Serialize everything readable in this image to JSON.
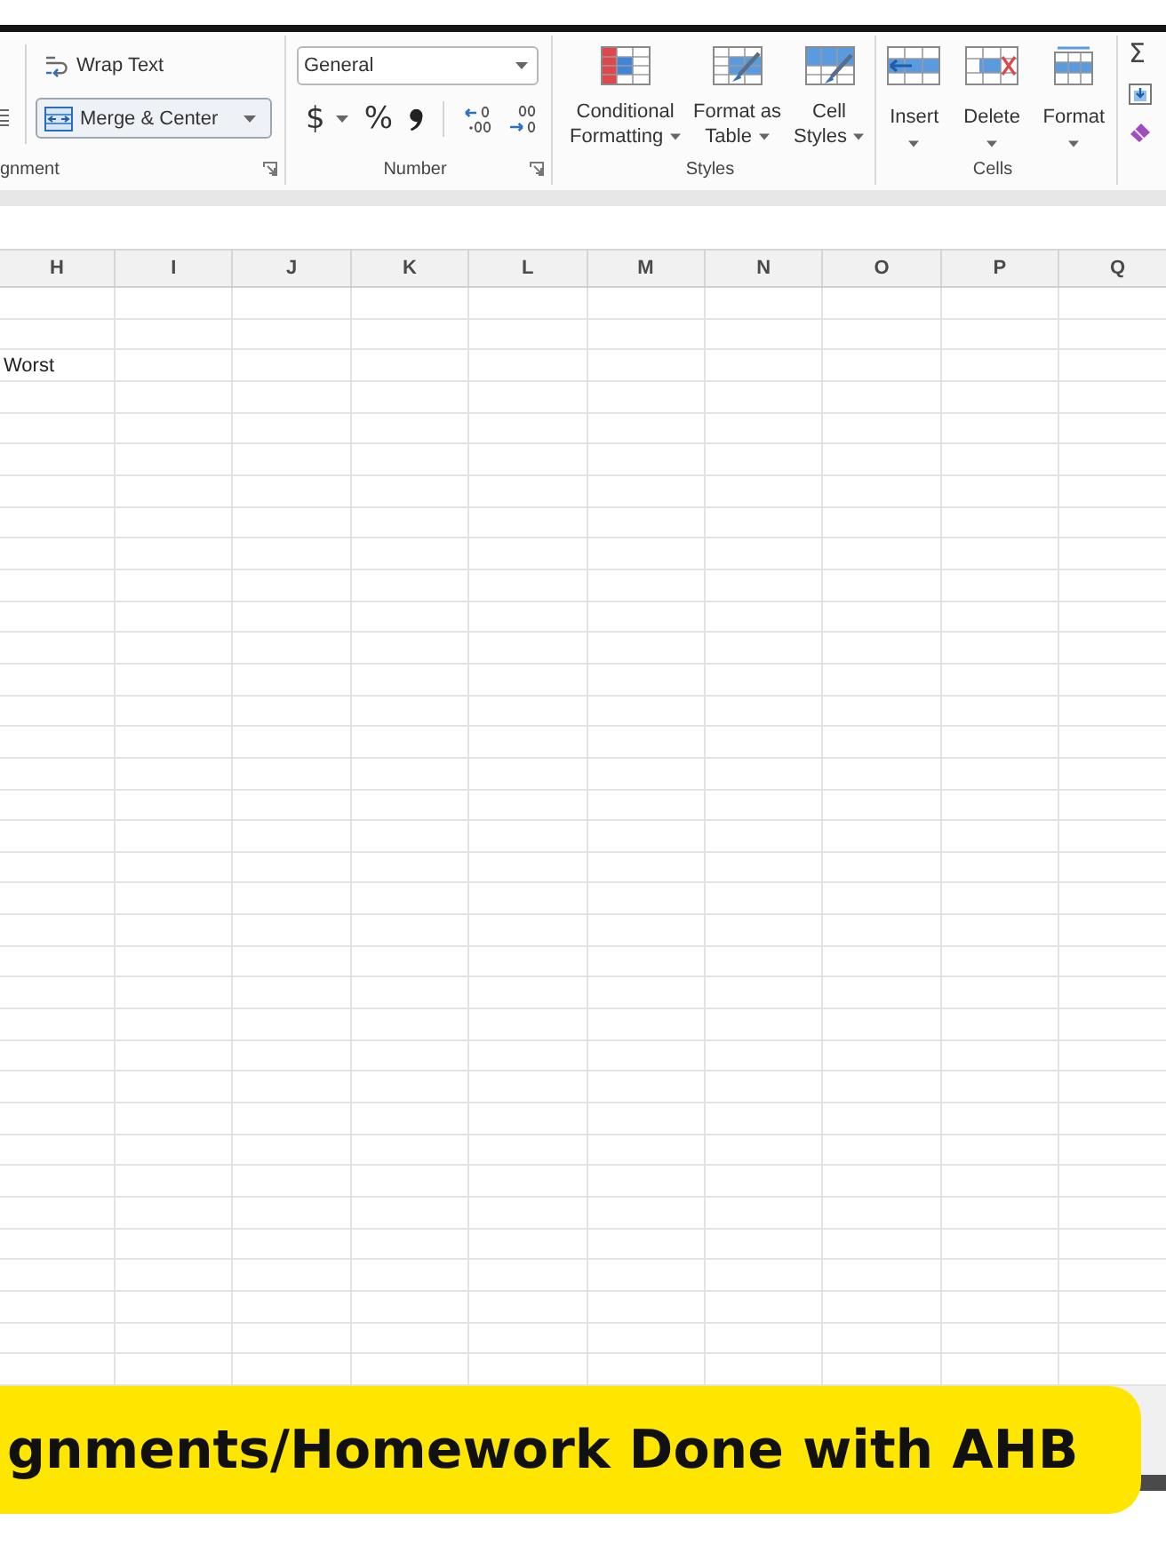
{
  "ribbon": {
    "alignment": {
      "label": "gnment",
      "wrap_text": "Wrap Text",
      "merge_center": {
        "label": "Merge & Center",
        "hovered": true
      }
    },
    "number": {
      "label": "Number",
      "format": {
        "value": "General"
      },
      "currency": "$",
      "percent": "%"
    },
    "styles": {
      "label": "Styles",
      "buttons": [
        {
          "lines": [
            "Conditional",
            "Formatting"
          ],
          "dropdown": true
        },
        {
          "lines": [
            "Format as",
            "Table"
          ],
          "dropdown": true
        },
        {
          "lines": [
            "Cell",
            "Styles"
          ],
          "dropdown": true
        }
      ]
    },
    "cells": {
      "label": "Cells",
      "buttons": [
        {
          "label": "Insert",
          "dropdown": true
        },
        {
          "label": "Delete",
          "dropdown": true
        },
        {
          "label": "Format",
          "dropdown": true
        }
      ]
    },
    "editing": {
      "autosum": "Σ"
    }
  },
  "sheet": {
    "columns": [
      {
        "label": "H",
        "entries": [
          "Worst"
        ]
      },
      {
        "label": "I"
      },
      {
        "label": "J"
      },
      {
        "label": "K"
      },
      {
        "label": "L"
      },
      {
        "label": "M"
      },
      {
        "label": "N"
      },
      {
        "label": "O"
      },
      {
        "label": "P"
      },
      {
        "label": "Q"
      }
    ]
  },
  "banner": {
    "text": "gnments/Homework Done with AHB"
  }
}
